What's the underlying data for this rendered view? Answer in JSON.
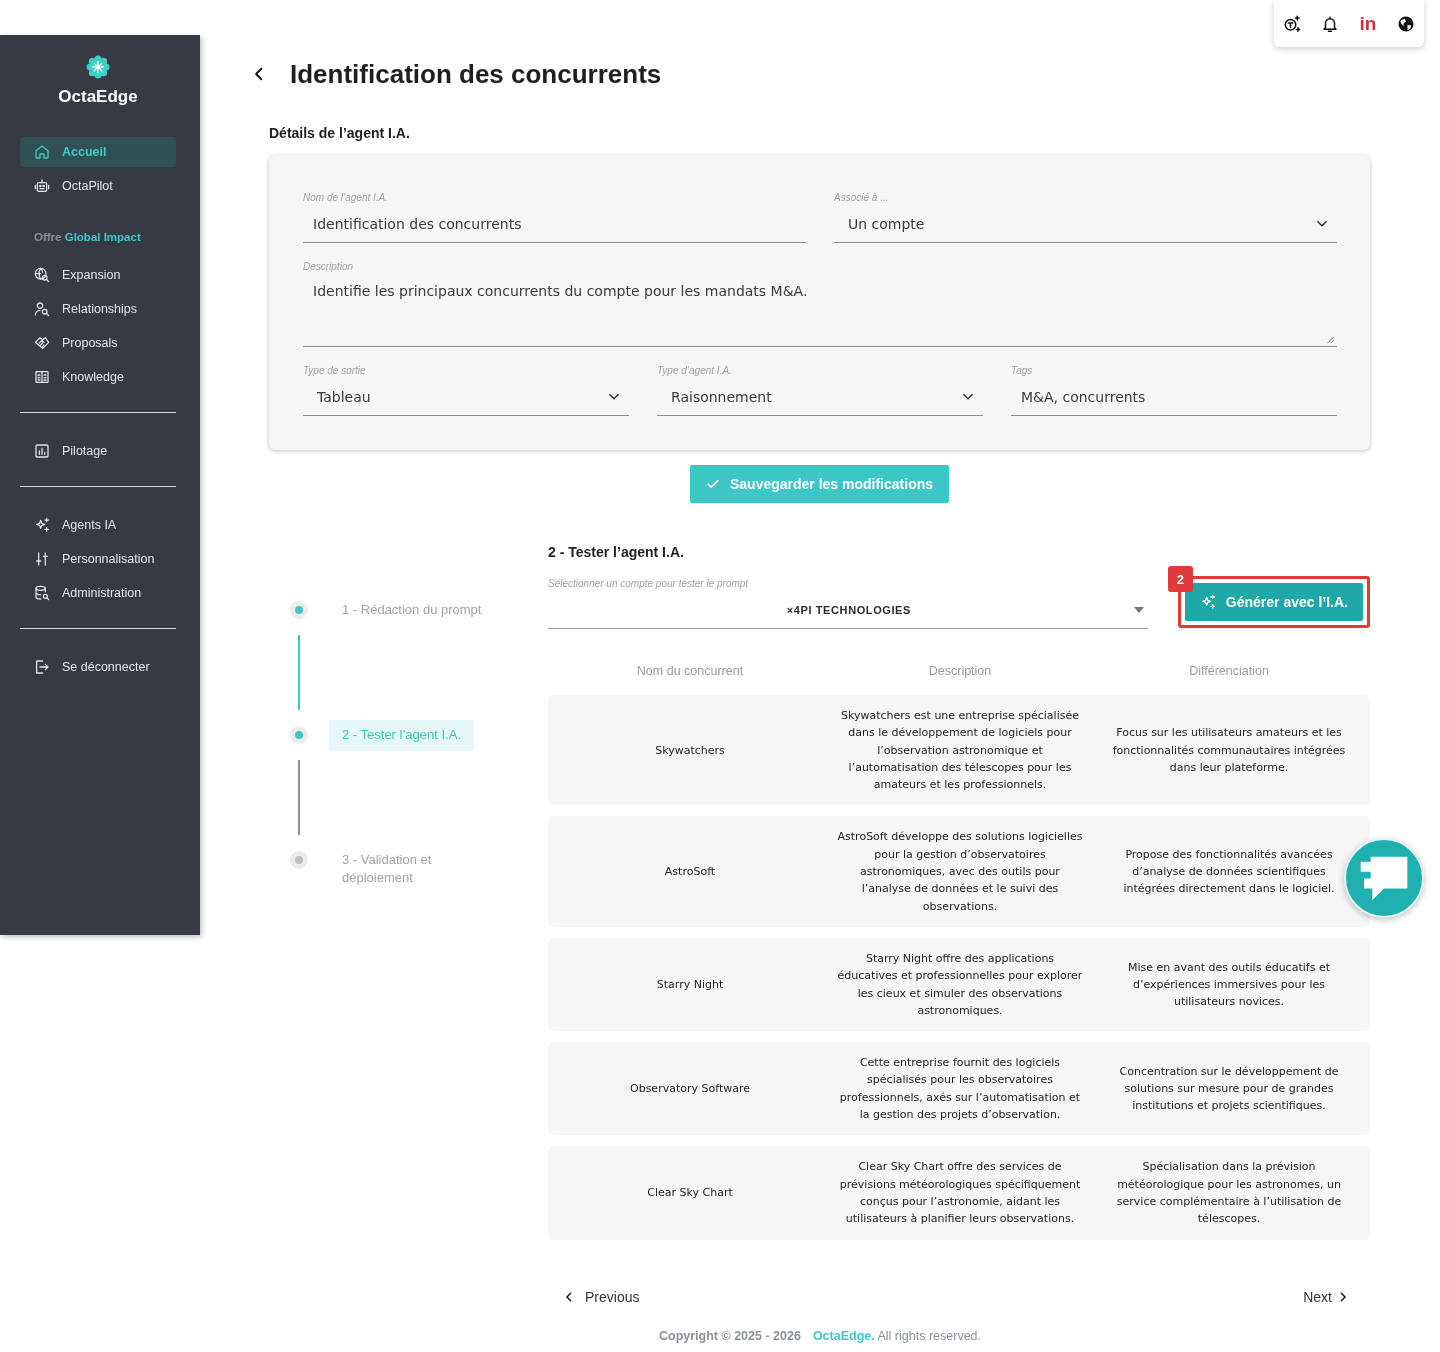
{
  "toolbar": {
    "social_label": "in"
  },
  "sidebar": {
    "brand": "OctaEdge",
    "sections": [
      {
        "items": [
          {
            "label": "Accueil",
            "selected": true
          },
          {
            "label": "OctaPilot",
            "selected": false
          }
        ]
      },
      {
        "heading": {
          "muted": "Offre",
          "accent": "Global Impact"
        },
        "items": [
          {
            "label": "Expansion",
            "selected": false
          },
          {
            "label": "Relationships",
            "selected": false
          },
          {
            "label": "Proposals",
            "selected": false
          },
          {
            "label": "Knowledge",
            "selected": false
          }
        ]
      },
      {
        "items": [
          {
            "label": "Pilotage",
            "selected": false
          }
        ]
      },
      {
        "items": [
          {
            "label": "Agents IA",
            "selected": false
          },
          {
            "label": "Personnalisation",
            "selected": false
          },
          {
            "label": "Administration",
            "selected": false
          }
        ]
      },
      {
        "items": [
          {
            "label": "Se déconnecter",
            "selected": false
          }
        ]
      }
    ]
  },
  "page": {
    "title": "Identification des concurrents"
  },
  "details": {
    "heading": "Détails de l’agent I.A.",
    "rows": [
      [
        {
          "kind": "text",
          "label": "Nom de l’agent I.A.",
          "value": "Identification des concurrents"
        },
        {
          "kind": "select",
          "label": "Associé à ...",
          "value": "Un compte"
        }
      ],
      [
        {
          "kind": "textarea",
          "label": "Description",
          "value": "Identifie les principaux concurrents du compte pour les mandats M&A."
        }
      ],
      [
        {
          "kind": "select",
          "label": "Type de sortie",
          "value": "Tableau"
        },
        {
          "kind": "select",
          "label": "Type d’agent I.A.",
          "value": "Raisonnement"
        },
        {
          "kind": "text",
          "label": "Tags",
          "value": "M&A, concurrents"
        }
      ]
    ],
    "save_button": "Sauvegarder les modifications"
  },
  "steps": [
    {
      "label": "1 - Rédaction du prompt",
      "selected": false
    },
    {
      "label": "2 - Tester l’agent I.A.",
      "selected": true
    },
    {
      "label": "3 - Validation et déploiement",
      "selected": false
    }
  ],
  "tester": {
    "heading": "2 - Tester l’agent I.A.",
    "account_select": {
      "label": "Sélectionner un compte pour tester le prompt",
      "value": "×4PI TECHNOLOGIES"
    },
    "generate_button": "Générer avec l’I.A.",
    "annotation_badge": "2",
    "table": {
      "columns": [
        "Nom du concurrent",
        "Description",
        "Différenciation"
      ],
      "rows": [
        [
          "Skywatchers",
          "Skywatchers est une entreprise spécialisée dans le développement de logiciels pour l’observation astronomique et l’automatisation des télescopes pour les amateurs et les professionnels.",
          "Focus sur les utilisateurs amateurs et les fonctionnalités communautaires intégrées dans leur plateforme."
        ],
        [
          "AstroSoft",
          "AstroSoft développe des solutions logicielles pour la gestion d’observatoires astronomiques, avec des outils pour l’analyse de données et le suivi des observations.",
          "Propose des fonctionnalités avancées d’analyse de données scientifiques intégrées directement dans le logiciel."
        ],
        [
          "Starry Night",
          "Starry Night offre des applications éducatives et professionnelles pour explorer les cieux et simuler des observations astronomiques.",
          "Mise en avant des outils éducatifs et d’expériences immersives pour les utilisateurs novices."
        ],
        [
          "Observatory Software",
          "Cette entreprise fournit des logiciels spécialisés pour les observatoires professionnels, axés sur l’automatisation et la gestion des projets d’observation.",
          "Concentration sur le développement de solutions sur mesure pour de grandes institutions et projets scientifiques."
        ],
        [
          "Clear Sky Chart",
          "Clear Sky Chart offre des services de prévisions météorologiques spécifiquement conçus pour l’astronomie, aidant les utilisateurs à planifier leurs observations.",
          "Spécialisation dans la prévision météorologique pour les astronomes, un service complémentaire à l’utilisation de télescopes."
        ]
      ]
    }
  },
  "pager": {
    "previous": "Previous",
    "next": "Next"
  },
  "footer": {
    "copyright": "Copyright © 2025 - 2026",
    "brand": "OctaEdge.",
    "rights": "All rights reserved."
  }
}
